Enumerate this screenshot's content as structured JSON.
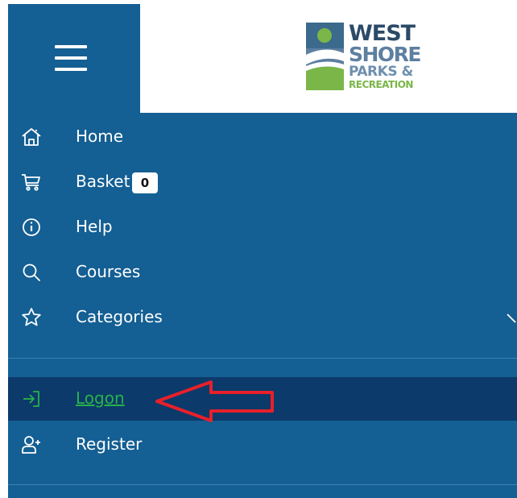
{
  "logo": {
    "line1": "WEST",
    "line2": "SHORE",
    "line3": "PARKS &",
    "line4": "RECREATION",
    "colors": {
      "dark": "#2c4a68",
      "mid": "#5d7fa0",
      "green": "#7ab648"
    }
  },
  "menu": {
    "items": [
      {
        "label": "Home",
        "icon": "home-icon"
      },
      {
        "label": "Basket",
        "icon": "cart-icon",
        "badge": "0"
      },
      {
        "label": "Help",
        "icon": "info-icon"
      },
      {
        "label": "Courses",
        "icon": "search-icon"
      },
      {
        "label": "Categories",
        "icon": "star-icon",
        "expandable": true
      },
      {
        "label": "Logon",
        "icon": "login-icon",
        "active": true
      },
      {
        "label": "Register",
        "icon": "add-user-icon"
      }
    ]
  },
  "colors": {
    "sidebar": "#145f93",
    "active_row": "#0c3a6a",
    "active_text": "#27b34a",
    "annotation_arrow": "#e8202a"
  }
}
